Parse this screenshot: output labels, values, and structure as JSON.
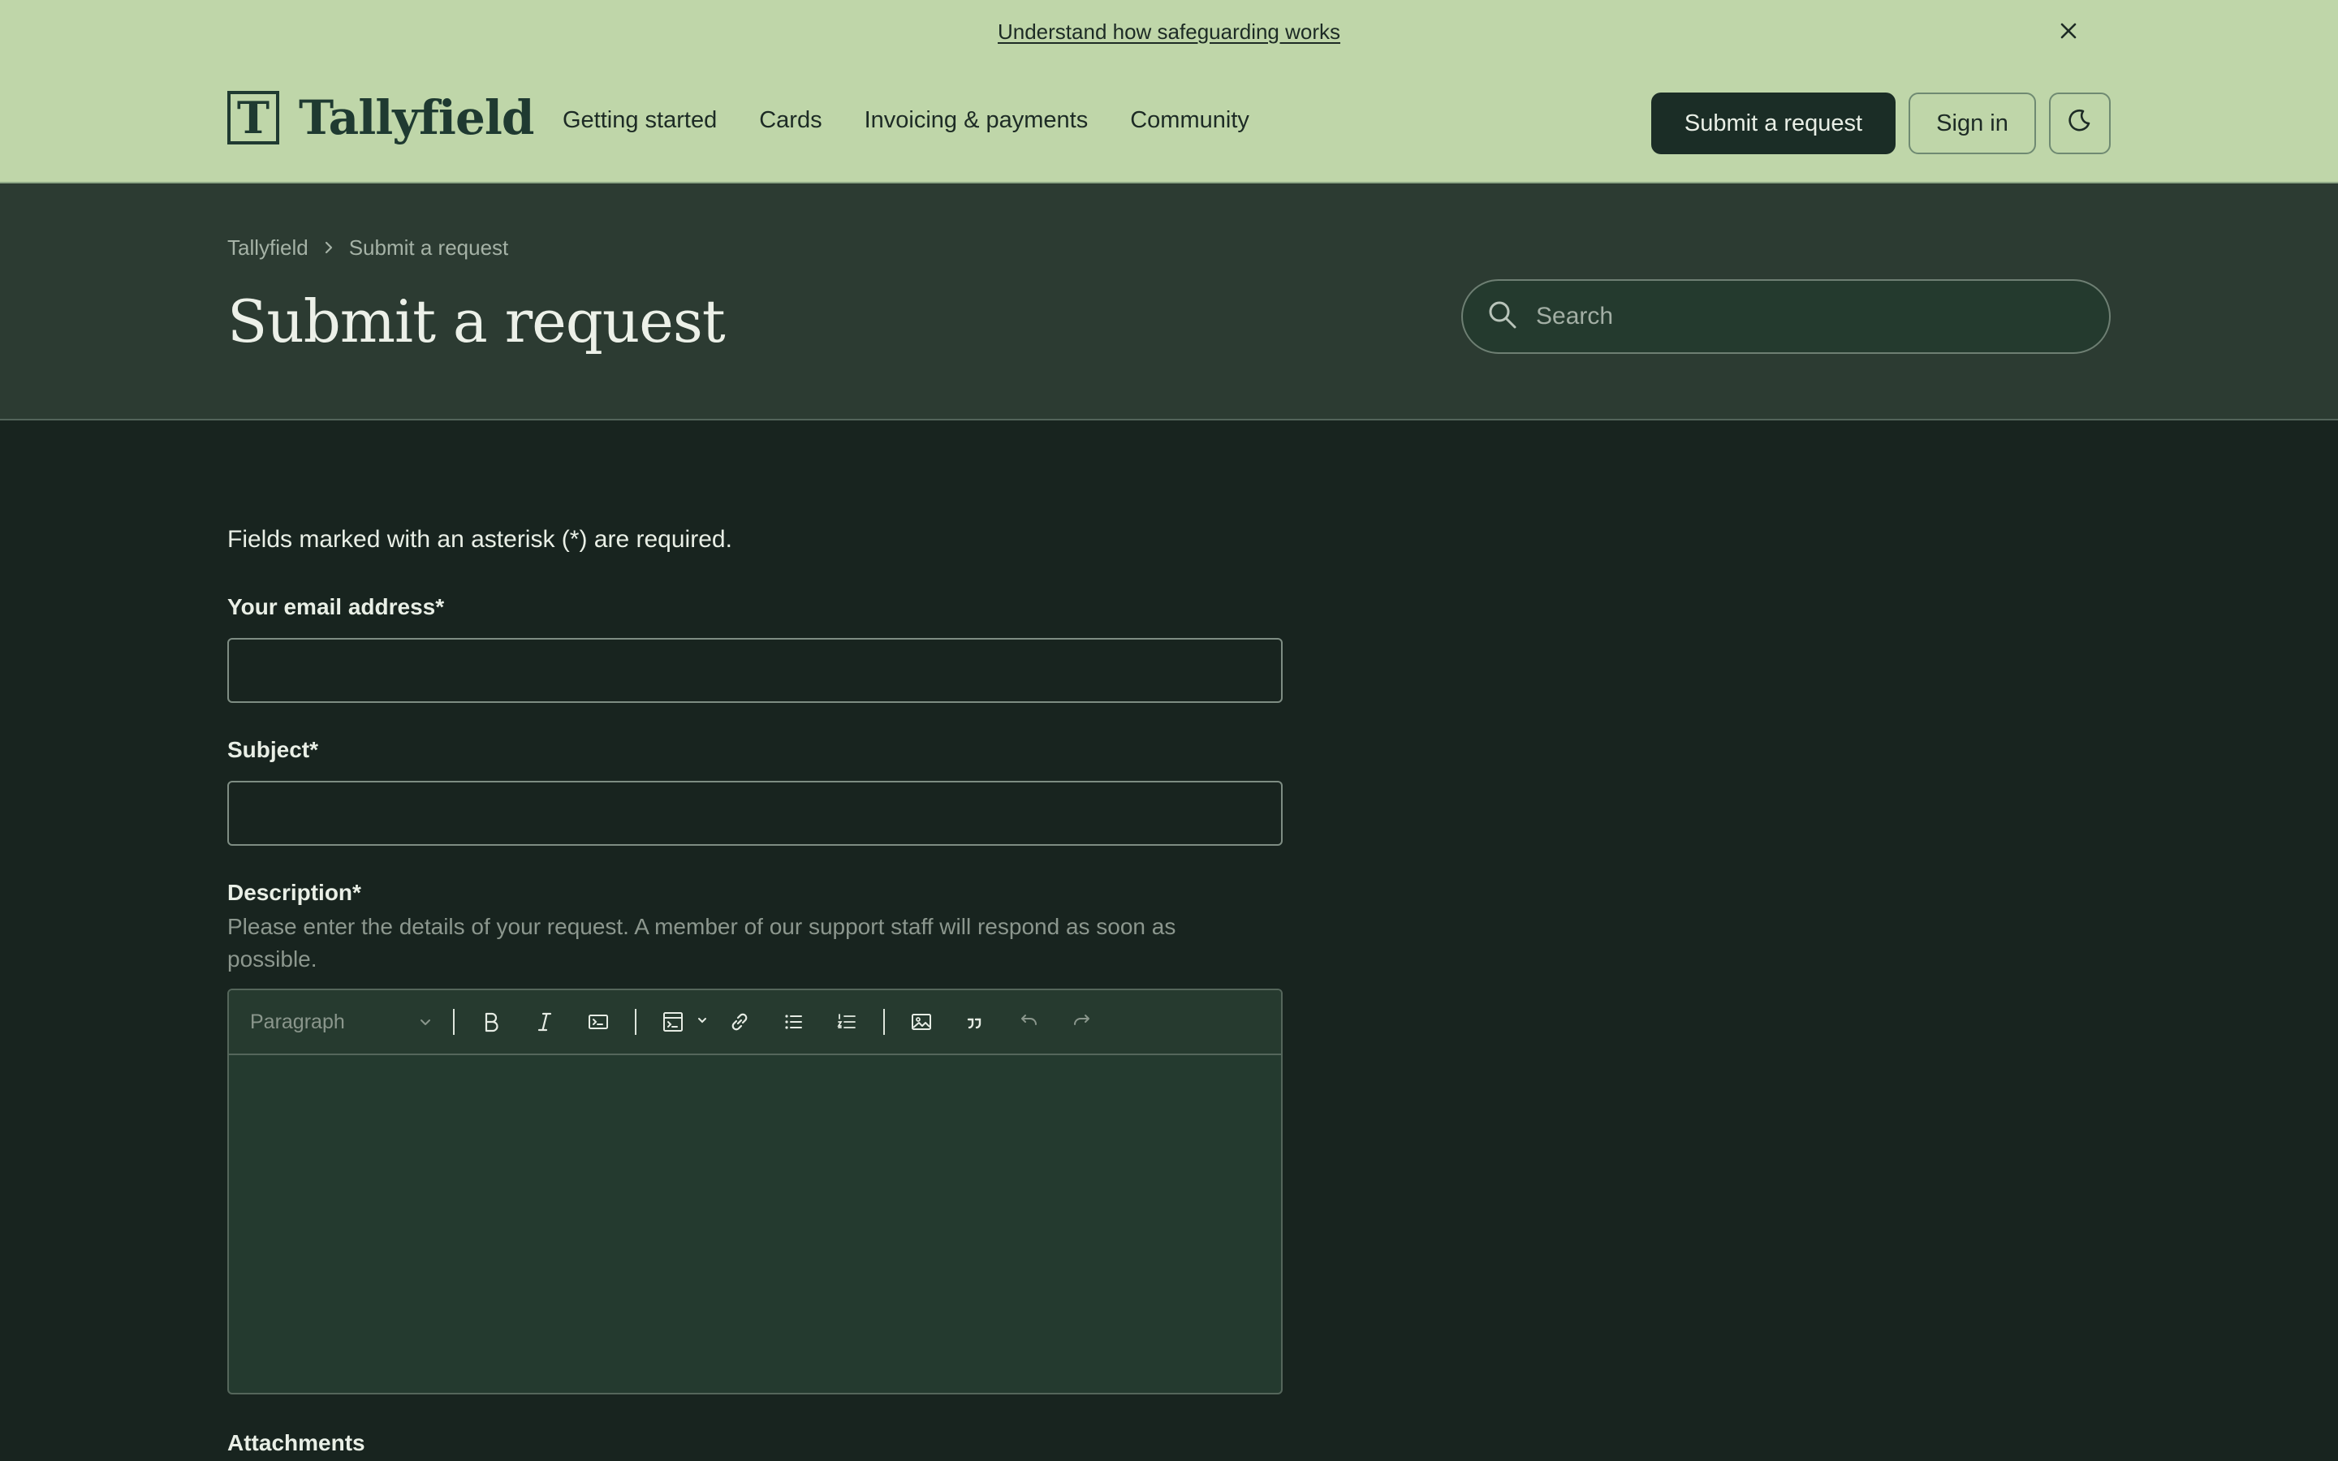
{
  "announcement": {
    "link_text": "Understand how safeguarding works",
    "close_icon": "close-icon"
  },
  "header": {
    "logo_letter": "T",
    "logo_text": "Tallyfield",
    "nav": [
      "Getting started",
      "Cards",
      "Invoicing & payments",
      "Community"
    ],
    "submit_label": "Submit a request",
    "signin_label": "Sign in",
    "theme_icon": "moon-icon"
  },
  "hero": {
    "breadcrumb": [
      "Tallyfield",
      "Submit a request"
    ],
    "title": "Submit a request",
    "search_placeholder": "Search"
  },
  "form": {
    "required_note": "Fields marked with an asterisk (*) are required.",
    "email_label": "Your email address*",
    "email_value": "",
    "subject_label": "Subject*",
    "subject_value": "",
    "description_label": "Description*",
    "description_hint": "Please enter the details of your request. A member of our support staff will respond as soon as possible.",
    "editor_format": "Paragraph",
    "attachments_label": "Attachments"
  },
  "colors": {
    "banner_bg": "#bfd6a9",
    "hero_bg": "#2c3b32",
    "page_bg": "#18241f",
    "primary_button": "#1b2d26"
  }
}
